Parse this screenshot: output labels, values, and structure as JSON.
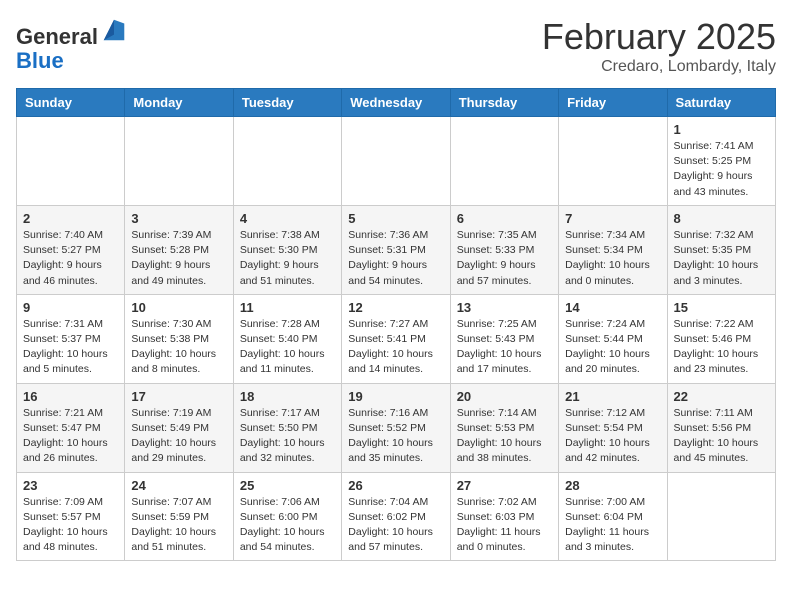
{
  "header": {
    "logo_general": "General",
    "logo_blue": "Blue",
    "month": "February 2025",
    "location": "Credaro, Lombardy, Italy"
  },
  "days_of_week": [
    "Sunday",
    "Monday",
    "Tuesday",
    "Wednesday",
    "Thursday",
    "Friday",
    "Saturday"
  ],
  "weeks": [
    [
      {
        "day": "",
        "info": ""
      },
      {
        "day": "",
        "info": ""
      },
      {
        "day": "",
        "info": ""
      },
      {
        "day": "",
        "info": ""
      },
      {
        "day": "",
        "info": ""
      },
      {
        "day": "",
        "info": ""
      },
      {
        "day": "1",
        "info": "Sunrise: 7:41 AM\nSunset: 5:25 PM\nDaylight: 9 hours and 43 minutes."
      }
    ],
    [
      {
        "day": "2",
        "info": "Sunrise: 7:40 AM\nSunset: 5:27 PM\nDaylight: 9 hours and 46 minutes."
      },
      {
        "day": "3",
        "info": "Sunrise: 7:39 AM\nSunset: 5:28 PM\nDaylight: 9 hours and 49 minutes."
      },
      {
        "day": "4",
        "info": "Sunrise: 7:38 AM\nSunset: 5:30 PM\nDaylight: 9 hours and 51 minutes."
      },
      {
        "day": "5",
        "info": "Sunrise: 7:36 AM\nSunset: 5:31 PM\nDaylight: 9 hours and 54 minutes."
      },
      {
        "day": "6",
        "info": "Sunrise: 7:35 AM\nSunset: 5:33 PM\nDaylight: 9 hours and 57 minutes."
      },
      {
        "day": "7",
        "info": "Sunrise: 7:34 AM\nSunset: 5:34 PM\nDaylight: 10 hours and 0 minutes."
      },
      {
        "day": "8",
        "info": "Sunrise: 7:32 AM\nSunset: 5:35 PM\nDaylight: 10 hours and 3 minutes."
      }
    ],
    [
      {
        "day": "9",
        "info": "Sunrise: 7:31 AM\nSunset: 5:37 PM\nDaylight: 10 hours and 5 minutes."
      },
      {
        "day": "10",
        "info": "Sunrise: 7:30 AM\nSunset: 5:38 PM\nDaylight: 10 hours and 8 minutes."
      },
      {
        "day": "11",
        "info": "Sunrise: 7:28 AM\nSunset: 5:40 PM\nDaylight: 10 hours and 11 minutes."
      },
      {
        "day": "12",
        "info": "Sunrise: 7:27 AM\nSunset: 5:41 PM\nDaylight: 10 hours and 14 minutes."
      },
      {
        "day": "13",
        "info": "Sunrise: 7:25 AM\nSunset: 5:43 PM\nDaylight: 10 hours and 17 minutes."
      },
      {
        "day": "14",
        "info": "Sunrise: 7:24 AM\nSunset: 5:44 PM\nDaylight: 10 hours and 20 minutes."
      },
      {
        "day": "15",
        "info": "Sunrise: 7:22 AM\nSunset: 5:46 PM\nDaylight: 10 hours and 23 minutes."
      }
    ],
    [
      {
        "day": "16",
        "info": "Sunrise: 7:21 AM\nSunset: 5:47 PM\nDaylight: 10 hours and 26 minutes."
      },
      {
        "day": "17",
        "info": "Sunrise: 7:19 AM\nSunset: 5:49 PM\nDaylight: 10 hours and 29 minutes."
      },
      {
        "day": "18",
        "info": "Sunrise: 7:17 AM\nSunset: 5:50 PM\nDaylight: 10 hours and 32 minutes."
      },
      {
        "day": "19",
        "info": "Sunrise: 7:16 AM\nSunset: 5:52 PM\nDaylight: 10 hours and 35 minutes."
      },
      {
        "day": "20",
        "info": "Sunrise: 7:14 AM\nSunset: 5:53 PM\nDaylight: 10 hours and 38 minutes."
      },
      {
        "day": "21",
        "info": "Sunrise: 7:12 AM\nSunset: 5:54 PM\nDaylight: 10 hours and 42 minutes."
      },
      {
        "day": "22",
        "info": "Sunrise: 7:11 AM\nSunset: 5:56 PM\nDaylight: 10 hours and 45 minutes."
      }
    ],
    [
      {
        "day": "23",
        "info": "Sunrise: 7:09 AM\nSunset: 5:57 PM\nDaylight: 10 hours and 48 minutes."
      },
      {
        "day": "24",
        "info": "Sunrise: 7:07 AM\nSunset: 5:59 PM\nDaylight: 10 hours and 51 minutes."
      },
      {
        "day": "25",
        "info": "Sunrise: 7:06 AM\nSunset: 6:00 PM\nDaylight: 10 hours and 54 minutes."
      },
      {
        "day": "26",
        "info": "Sunrise: 7:04 AM\nSunset: 6:02 PM\nDaylight: 10 hours and 57 minutes."
      },
      {
        "day": "27",
        "info": "Sunrise: 7:02 AM\nSunset: 6:03 PM\nDaylight: 11 hours and 0 minutes."
      },
      {
        "day": "28",
        "info": "Sunrise: 7:00 AM\nSunset: 6:04 PM\nDaylight: 11 hours and 3 minutes."
      },
      {
        "day": "",
        "info": ""
      }
    ]
  ]
}
